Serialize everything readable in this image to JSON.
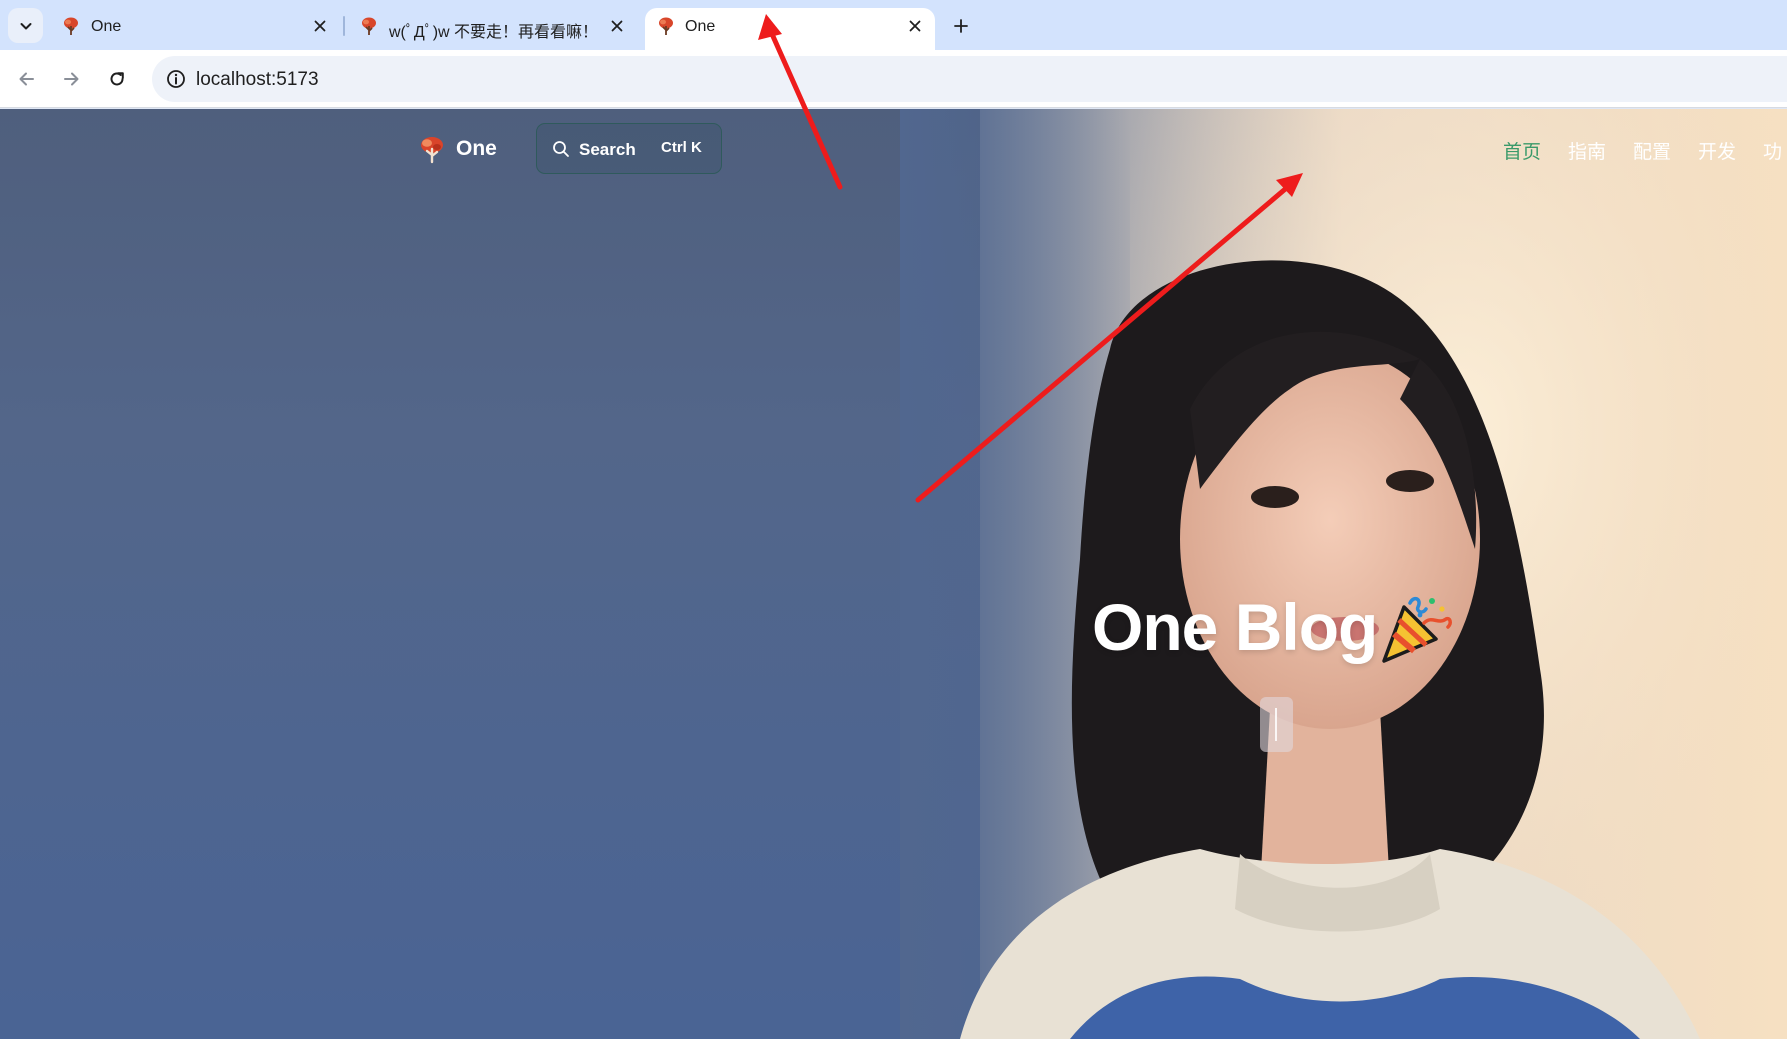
{
  "browser": {
    "tabs": [
      {
        "title": "One",
        "active": false
      },
      {
        "title": "w(ﾟДﾟ)w 不要走！再看看嘛！",
        "active": false
      },
      {
        "title": "One",
        "active": true
      }
    ],
    "address_bar": {
      "url": "localhost:5173"
    }
  },
  "site": {
    "name": "One",
    "search": {
      "label": "Search",
      "shortcut": "Ctrl K"
    },
    "nav": [
      {
        "label": "首页",
        "active": true
      },
      {
        "label": "指南",
        "active": false
      },
      {
        "label": "配置",
        "active": false
      },
      {
        "label": "开发",
        "active": false
      },
      {
        "label": "功",
        "active": false
      }
    ],
    "accent_color": "#3a9a6a"
  },
  "hero": {
    "title": "One Blog",
    "emoji_icon": "party-popper-icon"
  },
  "annotation": {
    "color": "#ee1c1c",
    "arrow_count": 2
  }
}
